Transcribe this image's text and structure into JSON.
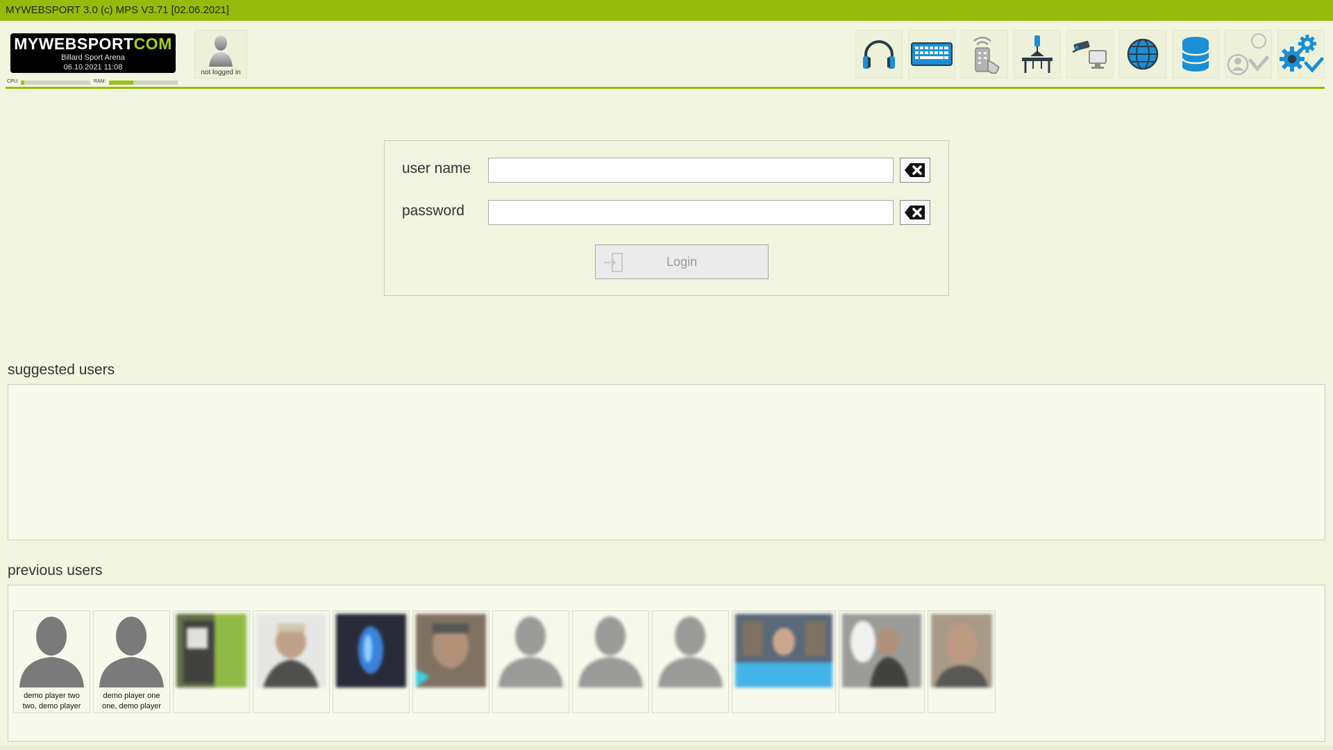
{
  "titlebar": {
    "text": "MYWEBSPORT 3.0  (c) MPS V3.71 [02.06.2021]"
  },
  "logo": {
    "brand_part1": "MYWEBSPORT",
    "brand_part2": "COM",
    "venue": "Billard Sport Arena",
    "datetime": "06.10.2021  11:08"
  },
  "meters": {
    "cpu_label": "CPU:",
    "ram_label": "RAM:",
    "cpu_level": 0.05,
    "ram_level": 0.35
  },
  "user": {
    "status": "not logged in",
    "icon": "user-avatar-icon"
  },
  "toolbar": {
    "icons": [
      "headphones-icon",
      "keyboard-icon",
      "remote-touch-icon",
      "table-lamp-icon",
      "camera-monitor-icon",
      "globe-icon",
      "database-icon",
      "user-check-icon",
      "settings-check-icon"
    ]
  },
  "login": {
    "username_label": "user name",
    "password_label": "password",
    "login_button": "Login"
  },
  "suggested": {
    "title": "suggested users"
  },
  "previous": {
    "title": "previous users",
    "players": [
      {
        "line1": "demo player two",
        "line2": "two, demo player"
      },
      {
        "line1": "demo player one",
        "line2": "one, demo player"
      }
    ]
  },
  "colors": {
    "accent": "#97bb0c",
    "background": "#f1f4df",
    "icon_blue": "#1a8fd6"
  }
}
